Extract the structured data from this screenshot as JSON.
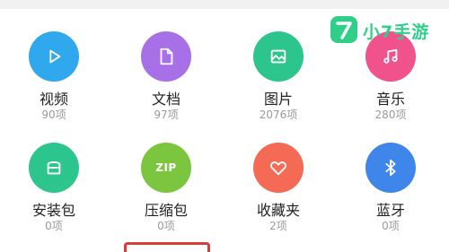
{
  "watermark": {
    "badge": "7",
    "text": "小7手游"
  },
  "categories": [
    {
      "label": "视频",
      "count": "90项",
      "icon": "play-icon",
      "color": "#2fa8ee"
    },
    {
      "label": "文档",
      "count": "97项",
      "icon": "document-icon",
      "color": "#a770e6"
    },
    {
      "label": "图片",
      "count": "2076项",
      "icon": "image-icon",
      "color": "#2cc58d"
    },
    {
      "label": "音乐",
      "count": "280项",
      "icon": "music-note-icon",
      "color": "#f0538b"
    },
    {
      "label": "安装包",
      "count": "0项",
      "icon": "package-icon",
      "color": "#2cc58d"
    },
    {
      "label": "压缩包",
      "count": "0项",
      "icon": "zip-icon",
      "icon_text": "ZIP",
      "color": "#7cc63f"
    },
    {
      "label": "收藏夹",
      "count": "2项",
      "icon": "heart-icon",
      "color": "#f46a55"
    },
    {
      "label": "蓝牙",
      "count": "0项",
      "icon": "bluetooth-icon",
      "color": "#3f86ea"
    }
  ]
}
